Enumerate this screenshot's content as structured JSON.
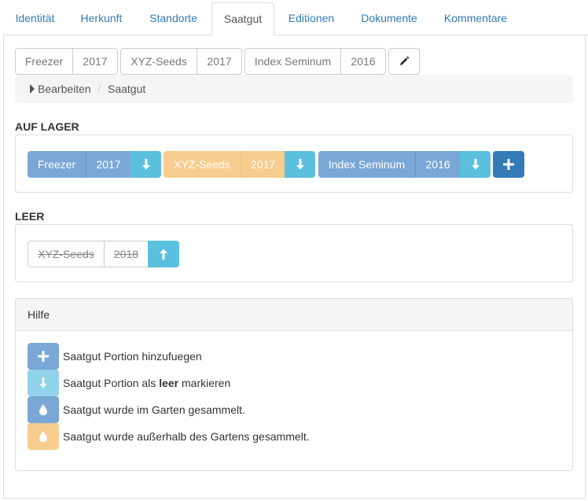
{
  "tabs": [
    {
      "label": "Identität"
    },
    {
      "label": "Herkunft"
    },
    {
      "label": "Standorte"
    },
    {
      "label": "Saatgut"
    },
    {
      "label": "Editionen"
    },
    {
      "label": "Dokumente"
    },
    {
      "label": "Kommentare"
    }
  ],
  "summary": [
    {
      "name": "Freezer",
      "year": "2017"
    },
    {
      "name": "XYZ-Seeds",
      "year": "2017"
    },
    {
      "name": "Index Seminum",
      "year": "2016"
    }
  ],
  "edit_button_icon": "pencil-icon",
  "breadcrumb": {
    "toggle": "Bearbeiten",
    "separator": "/",
    "current": "Saatgut"
  },
  "in_stock": {
    "title": "AUF LAGER",
    "items": [
      {
        "name": "Freezer",
        "year": "2017",
        "color": "#7aa7d6",
        "action_icon": "arrow-down-icon"
      },
      {
        "name": "XYZ-Seeds",
        "year": "2017",
        "color": "#f7cd8f",
        "action_icon": "arrow-down-icon"
      },
      {
        "name": "Index Seminum",
        "year": "2016",
        "color": "#7aa7d6",
        "action_icon": "arrow-down-icon"
      }
    ],
    "add_icon": "plus-icon"
  },
  "empty": {
    "title": "LEER",
    "items": [
      {
        "name": "XYZ-Seeds",
        "year": "2018",
        "action_icon": "arrow-up-icon"
      }
    ]
  },
  "help": {
    "title": "Hilfe",
    "rows": [
      {
        "icon": "plus-icon",
        "color": "#7aa7d6",
        "text_before": "Saatgut Portion hinzufuegen",
        "bold": "",
        "text_after": ""
      },
      {
        "icon": "arrow-down-icon",
        "color": "#92d2ea",
        "text_before": "Saatgut Portion als ",
        "bold": "leer",
        "text_after": " markieren"
      },
      {
        "icon": "drop-icon",
        "color": "#7aa7d6",
        "text_before": "Saatgut wurde im Garten gesammelt.",
        "bold": "",
        "text_after": ""
      },
      {
        "icon": "drop-icon",
        "color": "#f7cd8f",
        "text_before": "Saatgut wurde außerhalb des Gartens gesammelt.",
        "bold": "",
        "text_after": ""
      }
    ]
  },
  "colors": {
    "blue": "#7aa7d6",
    "orange": "#f7cd8f",
    "cyan": "#5bc0de",
    "dark_blue": "#337ab7",
    "light_cyan": "#92d2ea"
  }
}
